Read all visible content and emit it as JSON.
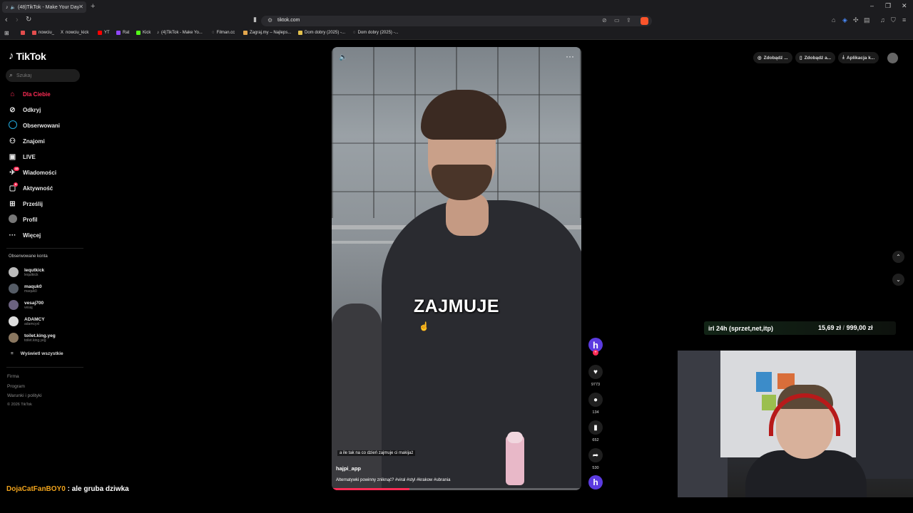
{
  "browser": {
    "tab_title": "(48)TikTok - Make Your Day",
    "url": "tiktok.com",
    "bookmarks": [
      {
        "label": "nowciu_",
        "color": "#e34d4d"
      },
      {
        "label": "nowciu_kick",
        "color": "#ffffff"
      },
      {
        "label": "YT",
        "color": "#ff0000"
      },
      {
        "label": "Rat",
        "color": "#9146ff"
      },
      {
        "label": "Kick",
        "color": "#53fc18"
      },
      {
        "label": "(4)TikTok - Make Yo...",
        "color": "#ffffff"
      },
      {
        "label": "Filman.cc",
        "color": "#cccccc"
      },
      {
        "label": "Zagraj.my – Najleps...",
        "color": "#e3a64d"
      },
      {
        "label": "Dom dobry (2025) -...",
        "color": "#e3c14d"
      },
      {
        "label": "Dom dobry (2025) -...",
        "color": "#cccccc"
      }
    ]
  },
  "sidebar": {
    "logo": "TikTok",
    "search_placeholder": "Szukaj",
    "nav": [
      {
        "label": "Dla Ciebie",
        "icon": "home-icon"
      },
      {
        "label": "Odkryj",
        "icon": "compass-icon"
      },
      {
        "label": "Obserwowani",
        "icon": "following-icon"
      },
      {
        "label": "Znajomi",
        "icon": "friends-icon"
      },
      {
        "label": "LIVE",
        "icon": "live-icon"
      },
      {
        "label": "Wiadomości",
        "icon": "messages-icon",
        "badge": "48"
      },
      {
        "label": "Aktywność",
        "icon": "activity-icon",
        "badge": "9"
      },
      {
        "label": "Prześlij",
        "icon": "upload-icon"
      },
      {
        "label": "Profil",
        "icon": "profile-icon"
      },
      {
        "label": "Więcej",
        "icon": "more-icon"
      }
    ],
    "followed_title": "Obserwowane konta",
    "accounts": [
      {
        "name": "lequtkick",
        "handle": "lequtkick"
      },
      {
        "name": "maquk0",
        "handle": "maquk0"
      },
      {
        "name": "vesaj700",
        "handle": "vesaj"
      },
      {
        "name": "ADAMCY",
        "handle": "adamcyxl"
      },
      {
        "name": "toilet.king.yeg",
        "handle": "toilet.king.yeg"
      }
    ],
    "see_all": "Wyświetl wszystkie",
    "footer": [
      "Firma",
      "Program",
      "Warunki i polityki"
    ],
    "copyright": "© 2026 TikTok"
  },
  "video": {
    "overlay_text": "ZAJMUJE",
    "sub_caption": "a ile tak na co dzień zajmuje ci makijaż",
    "author": "hajpi_app",
    "description": "Alternatywki powinny zniknąć? #viral #styl #krakow #ubrania",
    "progress_fraction": 0.31,
    "likes": "9773",
    "comments": "134",
    "saves": "652",
    "shares": "530"
  },
  "top_right": {
    "pill1": "Zdobądź ...",
    "pill2": "Zdobądź a...",
    "pill3": "Aplikacja k..."
  },
  "stream": {
    "irl_label": "irl 24h (sprzet,net,itp)",
    "irl_amount": "15,69 zł",
    "irl_separator": "/",
    "irl_goal": "999,00 zł",
    "chat_user": "DojaCatFanBOY0",
    "chat_sep": " : ",
    "chat_message": "ale gruba dziwka"
  }
}
